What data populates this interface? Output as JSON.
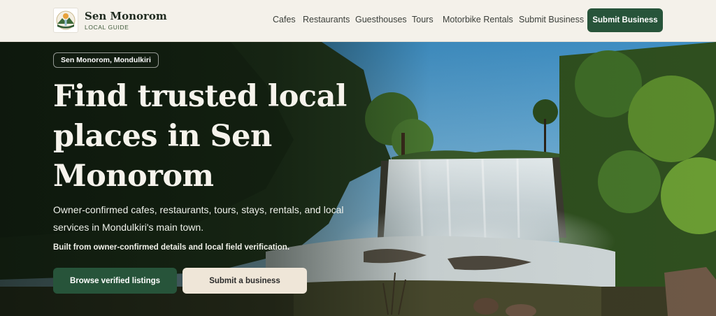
{
  "brand": {
    "name": "Sen Monorom",
    "tagline": "LOCAL GUIDE",
    "logo_icon": "waterfall-landscape-logo"
  },
  "nav": {
    "items": [
      {
        "label": "Cafes"
      },
      {
        "label": "Restaurants"
      },
      {
        "label": "Guesthouses"
      },
      {
        "label": "Tours"
      },
      {
        "label": "Motorbike Rentals"
      },
      {
        "label": "Submit Business"
      }
    ],
    "cta_label": "Submit Business"
  },
  "hero": {
    "location_pill": "Sen Monorom, Mondulkiri",
    "title": "Find trusted local places in Sen Monorom",
    "subtitle": "Owner-confirmed cafes, restaurants, tours, stays, rentals, and local services in Mondulkiri's main town.",
    "note": "Built from owner-confirmed details and local field verification.",
    "primary_button": "Browse verified listings",
    "secondary_button": "Submit a business",
    "background_image": "waterfall-jungle-photo"
  },
  "colors": {
    "header_bg": "#f4f1ea",
    "accent_green": "#27543a",
    "secondary_button_bg": "#efe6d8",
    "title_text": "#f6f3ec"
  }
}
